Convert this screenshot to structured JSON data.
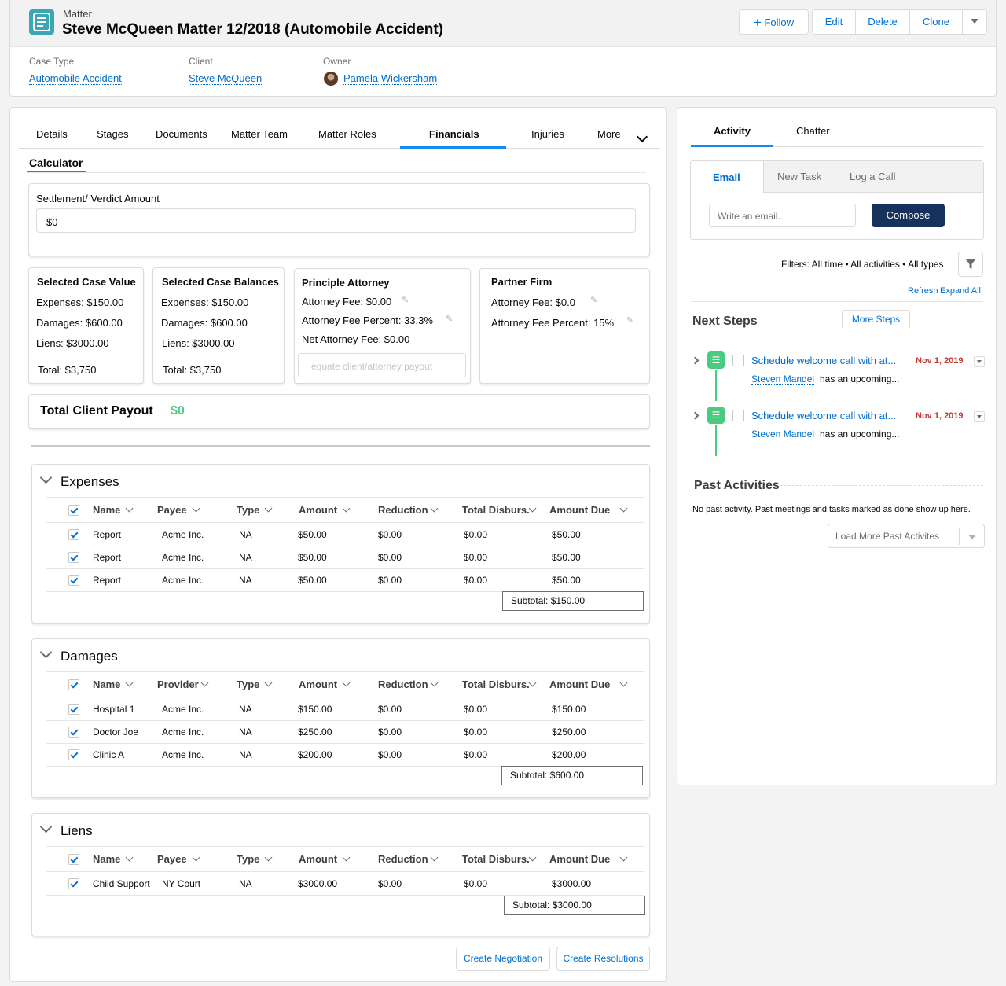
{
  "header": {
    "object_label": "Matter",
    "title": "Steve McQueen Matter 12/2018 (Automobile Accident)",
    "buttons": {
      "follow": "Follow",
      "edit": "Edit",
      "delete": "Delete",
      "clone": "Clone"
    },
    "fields": [
      {
        "label": "Case Type",
        "value": "Automobile Accident"
      },
      {
        "label": "Client",
        "value": "Steve McQueen"
      },
      {
        "label": "Owner",
        "value": "Pamela Wickersham"
      }
    ]
  },
  "tabs": [
    "Details",
    "Stages",
    "Documents",
    "Matter Team",
    "Matter Roles",
    "Financials",
    "Injuries",
    "More"
  ],
  "active_tab": "Financials",
  "calculator": {
    "title": "Calculator",
    "settlement_label": "Settlement/ Verdict Amount",
    "settlement_value": "$0",
    "selected_case_value": {
      "title": "Selected Case Value",
      "expenses": "Expenses: $150.00",
      "damages": "Damages: $600.00",
      "liens": "Liens: $3000.00",
      "total": "Total: $3,750"
    },
    "selected_case_balances": {
      "title": "Selected Case Balances",
      "expenses": "Expenses: $150.00",
      "damages": "Damages: $600.00",
      "liens": "Liens: $3000.00",
      "total": "Total: $3,750"
    },
    "principle_attorney": {
      "title": "Principle Attorney",
      "fee": "Attorney Fee: $0.00",
      "fee_percent": "Attorney Fee Percent: 33.3%",
      "net_fee": "Net Attorney Fee: $0.00",
      "input_placeholder": "equate client/attorney payout"
    },
    "partner_firm": {
      "title": "Partner Firm",
      "fee": "Attorney Fee: $0.0",
      "fee_percent": "Attorney Fee Percent: 15%"
    },
    "total_payout_label": "Total Client Payout",
    "total_payout_value": "$0",
    "payout_color": "#4bca81"
  },
  "expenses": {
    "title": "Expenses",
    "columns": [
      "Name",
      "Payee",
      "Type",
      "Amount",
      "Reduction",
      "Total Disburs.",
      "Amount Due"
    ],
    "rows": [
      [
        "Report",
        "Acme Inc.",
        "NA",
        "$50.00",
        "$0.00",
        "$0.00",
        "$50.00"
      ],
      [
        "Report",
        "Acme Inc.",
        "NA",
        "$50.00",
        "$0.00",
        "$0.00",
        "$50.00"
      ],
      [
        "Report",
        "Acme Inc.",
        "NA",
        "$50.00",
        "$0.00",
        "$0.00",
        "$50.00"
      ]
    ],
    "subtotal": "Subtotal: $150.00"
  },
  "damages": {
    "title": "Damages",
    "columns": [
      "Name",
      "Provider",
      "Type",
      "Amount",
      "Reduction",
      "Total Disburs.",
      "Amount Due"
    ],
    "rows": [
      [
        "Hospital 1",
        "Acme Inc.",
        "NA",
        "$150.00",
        "$0.00",
        "$0.00",
        "$150.00"
      ],
      [
        "Doctor Joe",
        "Acme Inc.",
        "NA",
        "$250.00",
        "$0.00",
        "$0.00",
        "$250.00"
      ],
      [
        "Clinic A",
        "Acme Inc.",
        "NA",
        "$200.00",
        "$0.00",
        "$0.00",
        "$200.00"
      ]
    ],
    "subtotal": "Subtotal: $600.00"
  },
  "liens": {
    "title": "Liens",
    "columns": [
      "Name",
      "Payee",
      "Type",
      "Amount",
      "Reduction",
      "Total Disburs.",
      "Amount Due"
    ],
    "rows": [
      [
        "Child Support",
        "NY Court",
        "NA",
        "$3000.00",
        "$0.00",
        "$0.00",
        "$3000.00"
      ]
    ],
    "subtotal": "Subtotal: $3000.00"
  },
  "footer_buttons": {
    "negotiation": "Create Negotiation",
    "resolutions": "Create Resolutions"
  },
  "activity": {
    "tabs": {
      "activity": "Activity",
      "chatter": "Chatter"
    },
    "subtabs": {
      "email": "Email",
      "new_task": "New Task",
      "log_call": "Log a Call"
    },
    "email_placeholder": "Write an email...",
    "compose": "Compose",
    "filters": "Filters: All time • All activities • All types",
    "refresh": "Refresh",
    "expand_all": "Expand All",
    "next_steps_title": "Next Steps",
    "more_steps": "More Steps",
    "steps": [
      {
        "subject": "Schedule welcome call with at...",
        "date": "Nov 1, 2019",
        "person": "Steven Mandel",
        "detail": "has an upcoming..."
      },
      {
        "subject": "Schedule welcome call with at...",
        "date": "Nov 1, 2019",
        "person": "Steven Mandel",
        "detail": "has an upcoming..."
      }
    ],
    "past_title": "Past Activities",
    "past_empty": "No past activity. Past meetings and tasks marked as done show up here.",
    "load_more": "Load More Past Activites"
  }
}
